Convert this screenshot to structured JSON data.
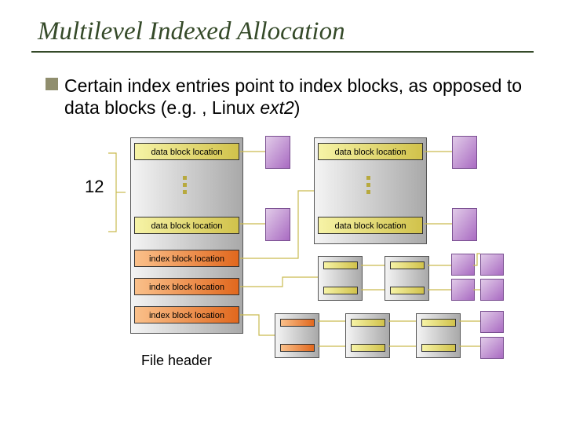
{
  "title": "Multilevel Indexed Allocation",
  "bullet": {
    "prefix": "Certain index entries point to index blocks, as opposed to data blocks (e.g. , Linux ",
    "italic": "ext2",
    "suffix": ")"
  },
  "labels": {
    "twelve": "12",
    "file_header": "File header"
  },
  "slots": {
    "data": "data block location",
    "index": "index block location"
  }
}
